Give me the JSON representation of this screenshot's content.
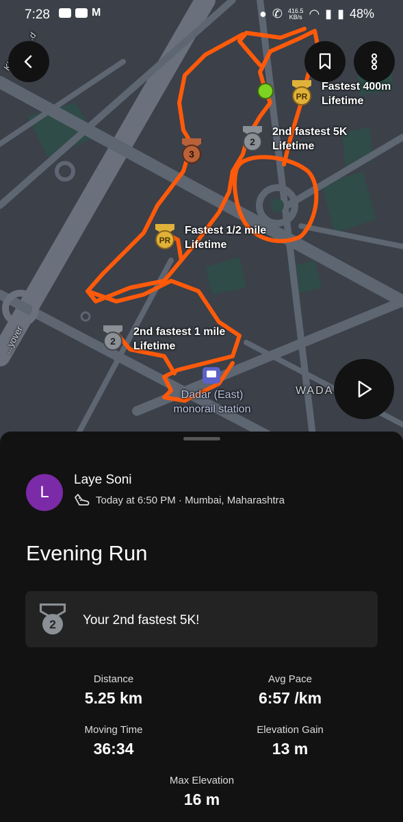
{
  "status_bar": {
    "time": "7:28",
    "app_icons": [
      "youtube-icon",
      "youtube-icon",
      "m-app-icon"
    ],
    "m_glyph": "M",
    "net_speed_value": "416.5",
    "net_speed_unit": "KB/s",
    "battery": "48%"
  },
  "map": {
    "labels": {
      "road_top_left": "Kharegh...d",
      "road_left": "...yover",
      "area_right": "WADA",
      "station": "Dadar (East)\nmonorail station"
    },
    "achievements_on_map": [
      {
        "badge": "PR",
        "title": "Fastest 400m",
        "sub": "Lifetime"
      },
      {
        "badge": "2",
        "title": "2nd fastest 5K",
        "sub": "Lifetime"
      },
      {
        "badge": "3",
        "title": "",
        "sub": ""
      },
      {
        "badge": "PR",
        "title": "Fastest 1/2 mile",
        "sub": "Lifetime"
      },
      {
        "badge": "2",
        "title": "2nd fastest 1 mile",
        "sub": "Lifetime"
      }
    ],
    "colors": {
      "route": "#ff5a0a",
      "start_dot": "#7ed321",
      "pr_gold": "#e0b23a",
      "silver": "#8b8f96",
      "bronze": "#b9623a"
    }
  },
  "activity": {
    "athlete_name": "Laye Soni",
    "avatar_initial": "L",
    "avatar_color": "#7b2aa8",
    "meta": "Today at 6:50 PM · Mumbai, Maharashtra",
    "title": "Evening Run",
    "highlight": "Your 2nd fastest 5K!",
    "highlight_badge": "2",
    "stats": {
      "distance": {
        "label": "Distance",
        "value": "5.25 km"
      },
      "avg_pace": {
        "label": "Avg Pace",
        "value": "6:57 /km"
      },
      "moving_time": {
        "label": "Moving Time",
        "value": "36:34"
      },
      "elevation_gain": {
        "label": "Elevation Gain",
        "value": "13 m"
      },
      "max_elevation": {
        "label": "Max Elevation",
        "value": "16 m"
      }
    }
  }
}
